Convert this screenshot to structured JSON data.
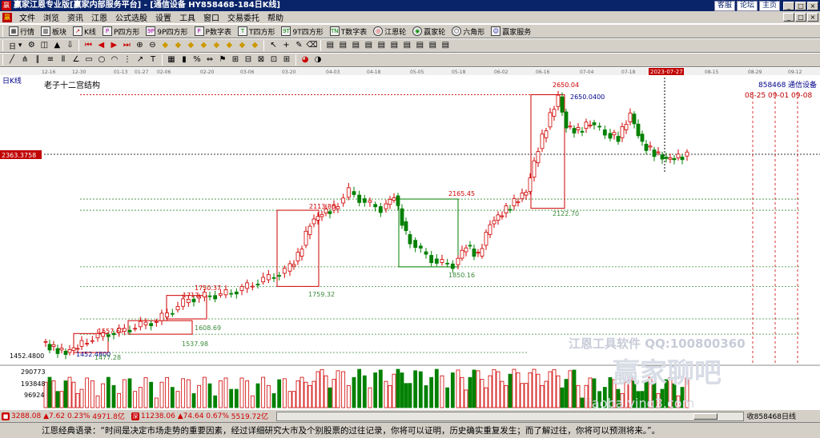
{
  "window": {
    "title": "赢家江恩专业版[赢家内部服务平台] - [通信设备  HY858468-184日K线]",
    "links": [
      "客服",
      "论坛",
      "主页"
    ],
    "win_buttons": [
      "_",
      "□",
      "×"
    ]
  },
  "menubar": {
    "items": [
      "文件",
      "浏览",
      "资讯",
      "江恩",
      "公式选股",
      "设置",
      "工具",
      "窗口",
      "交易委托",
      "帮助"
    ],
    "right_buttons": [
      "_",
      "□",
      "×"
    ]
  },
  "toolbar1": {
    "items": [
      "行情",
      "板块",
      "K线",
      "P四方形",
      "9P四方形",
      "P数字表",
      "T四方形",
      "9T四方形",
      "T数字表",
      "江恩轮",
      "赢家轮",
      "六角形",
      "赢家服务"
    ]
  },
  "toolbar2": {
    "items": [
      "日",
      "⚙",
      "◫",
      "📈",
      "◇",
      "◇",
      "◇",
      "◇",
      "◇",
      "◇",
      "◇",
      "◇",
      "◇",
      "◇",
      "◇",
      "◇",
      "◇",
      "◇",
      "↖",
      "+",
      "✎",
      "▤",
      "▤",
      "▤",
      "▤",
      "▤",
      "▤",
      "▤",
      "▤",
      "▤",
      "▤"
    ]
  },
  "chart_data": {
    "type": "candlestick",
    "period_label": "日K线",
    "subtitle": "老子十二宫结构",
    "symbol_code": "858468",
    "symbol_name": "通信设备",
    "right_dates": "08-25 09-01 09-08",
    "date_ticks": [
      "12-16",
      "12-30",
      "01-13",
      "01-27",
      "02-06",
      "02-20",
      "03-06",
      "03-20",
      "04-03",
      "04-18",
      "05-05",
      "05-18",
      "06-02",
      "06-16",
      "07-04",
      "07-18",
      "2023-07-27",
      "08-15",
      "08-29",
      "09-12"
    ],
    "price_labels": {
      "current_left": "2363.3758",
      "low_left": "1452.4800"
    },
    "volume_labels": [
      "290773",
      "193848",
      "96924"
    ],
    "annotations": [
      "2650.04",
      "2650.0400",
      "2122.70",
      "2165.45",
      "2113.86",
      "1850.16",
      "1759.32",
      "1750.37",
      "1717.",
      "1608.69",
      "1557.67",
      "1537.98",
      "1452.4800",
      "1477.28"
    ],
    "watermark_lines": [
      "江恩工具软件  QQ:100800360",
      "赢家聊吧",
      "jiaoba.ying3.com"
    ]
  },
  "statusbar": {
    "sh_value": "3288.08",
    "sh_change": "▲7.62",
    "sh_pct": "0.23%",
    "sh_amount": "4971.8亿",
    "sz_value": "11238.06",
    "sz_change": "▲74.64",
    "sz_pct": "0.67%",
    "sz_amount": "5519.72亿",
    "right_label": "收858468日线"
  },
  "quote": {
    "text": "江恩经典语录：“时间是决定市场走势的重要因素，经过详细研究大市及个别股票的过往记录，你将可以证明，历史确实重复发生；而了解过往，你将可以预测将来。”。"
  },
  "colors": {
    "up": "#d00000",
    "down": "#008000",
    "title_bg": "#0a246a",
    "chrome": "#d4d0c8"
  }
}
